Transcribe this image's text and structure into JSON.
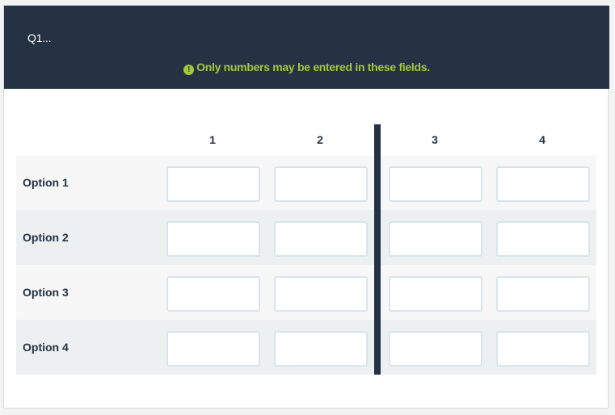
{
  "question": {
    "label": "Q1...",
    "warning": "Only numbers may be entered in these fields.",
    "warning_icon": "exclamation-circle-icon"
  },
  "columns": [
    "1",
    "2",
    "3",
    "4"
  ],
  "rows": [
    {
      "label": "Option 1",
      "values": [
        "",
        "",
        "",
        ""
      ]
    },
    {
      "label": "Option 2",
      "values": [
        "",
        "",
        "",
        ""
      ]
    },
    {
      "label": "Option 3",
      "values": [
        "",
        "",
        "",
        ""
      ]
    },
    {
      "label": "Option 4",
      "values": [
        "",
        "",
        "",
        ""
      ]
    }
  ],
  "colors": {
    "header_bg": "#253243",
    "warning": "#a5c73a",
    "divider": "#253243",
    "row_odd": "#f7f7f7",
    "row_even": "#edf0f1",
    "input_border": "#d9e4ec"
  }
}
